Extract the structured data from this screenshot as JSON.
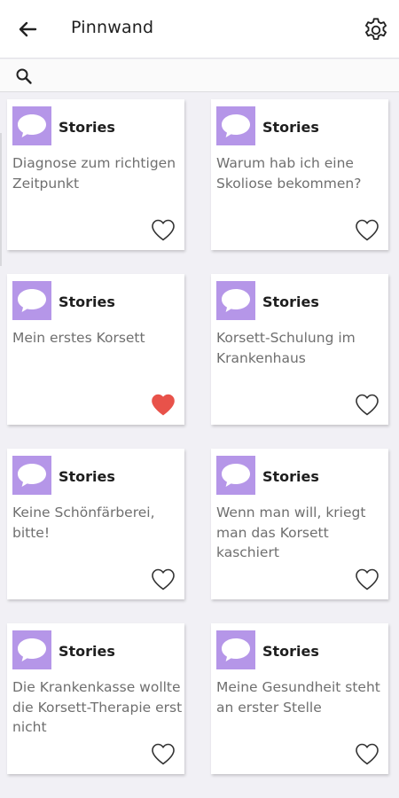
{
  "header": {
    "title": "Pinnwand"
  },
  "search": {
    "placeholder": ""
  },
  "colors": {
    "badge": "#b596e8",
    "heart_liked": "#e8524a",
    "heart_outline": "#333333"
  },
  "cards": [
    {
      "category": "Stories",
      "text": "Diagnose zum richtigen Zeitpunkt",
      "liked": false
    },
    {
      "category": "Stories",
      "text": "Warum hab ich eine Skoliose bekommen?",
      "liked": false
    },
    {
      "category": "Stories",
      "text": "Mein erstes Korsett",
      "liked": true
    },
    {
      "category": "Stories",
      "text": "Korsett-Schulung im Krankenhaus",
      "liked": false
    },
    {
      "category": "Stories",
      "text": "Keine Schönfärberei, bitte!",
      "liked": false
    },
    {
      "category": "Stories",
      "text": "Wenn man will, kriegt man das Korsett kaschiert",
      "liked": false
    },
    {
      "category": "Stories",
      "text": "Die Krankenkasse wollte die Korsett-Therapie erst nicht",
      "liked": false
    },
    {
      "category": "Stories",
      "text": "Meine Gesundheit steht an erster Stelle",
      "liked": false
    }
  ],
  "icons": {
    "back": "arrow-left-icon",
    "settings": "gear-icon",
    "search": "search-icon",
    "badge": "speech-bubble-icon",
    "like": "heart-icon"
  }
}
